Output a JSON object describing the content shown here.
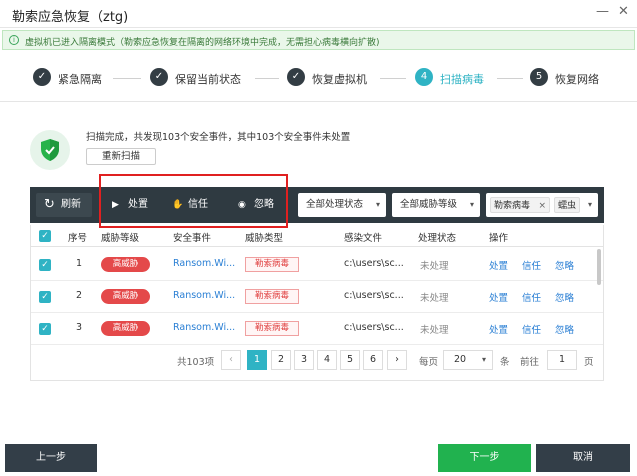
{
  "window": {
    "title": "勒索应急恢复（ztg)",
    "minimize_glyph": "—",
    "close_glyph": "✕"
  },
  "banner": {
    "icon": "i",
    "text": "虚拟机已进入隔离模式（勒索应急恢复在隔离的网络环境中完成，无需担心病毒横向扩散)"
  },
  "steps": [
    {
      "num": "✓",
      "label": "紧急隔离",
      "state": "done"
    },
    {
      "num": "✓",
      "label": "保留当前状态",
      "state": "done"
    },
    {
      "num": "✓",
      "label": "恢复虚拟机",
      "state": "done"
    },
    {
      "num": "4",
      "label": "扫描病毒",
      "state": "active"
    },
    {
      "num": "5",
      "label": "恢复网络",
      "state": "todo"
    }
  ],
  "scan": {
    "summary": "扫描完成，共发现103个安全事件，其中103个安全事件未处置",
    "rescan_label": "重新扫描"
  },
  "toolbar": {
    "refresh": {
      "icon": "↻",
      "label": "刷新"
    },
    "handle": {
      "icon": "▶",
      "label": "处置"
    },
    "trust": {
      "icon": "✋",
      "label": "信任"
    },
    "ignore": {
      "icon": "◉",
      "label": "忽略"
    },
    "status_filter": "全部处理状态",
    "level_filter": "全部威胁等级",
    "tag1": "勒索病毒",
    "tag1_close": "×",
    "tag2": "蠕虫",
    "caret": "▾"
  },
  "table": {
    "headers": {
      "index": "序号",
      "level": "威胁等级",
      "event": "安全事件",
      "type": "威胁类型",
      "file": "感染文件",
      "status": "处理状态",
      "action": "操作"
    },
    "rows": [
      {
        "index": "1",
        "level": "高威胁",
        "event": "Ransom.Wi...",
        "type": "勒索病毒",
        "file": "c:\\users\\sc...",
        "status": "未处理",
        "a1": "处置",
        "a2": "信任",
        "a3": "忽略"
      },
      {
        "index": "2",
        "level": "高威胁",
        "event": "Ransom.Wi...",
        "type": "勒索病毒",
        "file": "c:\\users\\sc...",
        "status": "未处理",
        "a1": "处置",
        "a2": "信任",
        "a3": "忽略"
      },
      {
        "index": "3",
        "level": "高威胁",
        "event": "Ransom.Wi...",
        "type": "勒索病毒",
        "file": "c:\\users\\sc...",
        "status": "未处理",
        "a1": "处置",
        "a2": "信任",
        "a3": "忽略"
      }
    ],
    "check_glyph": "✓"
  },
  "pagination": {
    "total": "共103项",
    "prev": "‹",
    "next": "›",
    "pages": [
      "1",
      "2",
      "3",
      "4",
      "5",
      "6"
    ],
    "per_page_label": "每页",
    "per_page_value": "20",
    "unit": "条",
    "goto_label": "前往",
    "goto_value": "1",
    "page_unit": "页"
  },
  "footer": {
    "prev_label": "上一步",
    "next_label": "下一步",
    "cancel_label": "取消"
  },
  "colors": {
    "accent": "#2fb3c4",
    "toolbar_bg": "#2f3a41",
    "danger": "#e4494a",
    "success": "#21b24f",
    "highlight": "#e02020"
  }
}
